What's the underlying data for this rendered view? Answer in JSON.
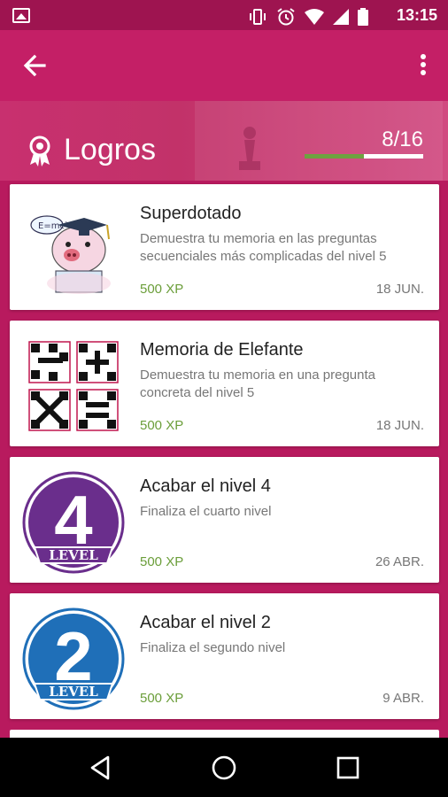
{
  "status_bar": {
    "time": "13:15",
    "icons": [
      "image-icon",
      "vibrate-icon",
      "alarm-icon",
      "wifi-icon",
      "signal-icon",
      "battery-icon"
    ]
  },
  "app_bar": {
    "back_icon": "arrow-back-icon",
    "menu_icon": "more-vert-icon"
  },
  "header": {
    "title": "Logros",
    "icon": "award-ribbon-icon",
    "progress_text": "8/16",
    "progress_fraction": 0.5
  },
  "achievements": [
    {
      "name": "Superdotado",
      "description": "Demuestra tu memoria en las preguntas secuenciales más complicadas del nivel 5",
      "xp": "500 XP",
      "date": "18 JUN.",
      "image": "genius-pig-illustration"
    },
    {
      "name": "Memoria de Elefante",
      "description": "Demuestra tu memoria en una pregunta concreta del nivel 5",
      "xp": "500 XP",
      "date": "18 JUN.",
      "image": "math-operators-grid"
    },
    {
      "name": "Acabar el nivel 4",
      "description": "Finaliza el cuarto nivel",
      "xp": "500 XP",
      "date": "26 ABR.",
      "image": "level-4-badge",
      "badge_number": "4",
      "badge_label": "LEVEL",
      "badge_color": "#6a2e8c"
    },
    {
      "name": "Acabar el nivel 2",
      "description": "Finaliza el segundo nivel",
      "xp": "500 XP",
      "date": "9 ABR.",
      "image": "level-2-badge",
      "badge_number": "2",
      "badge_label": "LEVEL",
      "badge_color": "#1f6fb8"
    }
  ],
  "nav_bar": {
    "back": "nav-back-icon",
    "home": "nav-home-icon",
    "recents": "nav-recents-icon"
  },
  "colors": {
    "primary": "#c41f66",
    "status_bar": "#9e1450",
    "xp_green": "#6b9e3a",
    "progress_green": "#6ea240"
  }
}
